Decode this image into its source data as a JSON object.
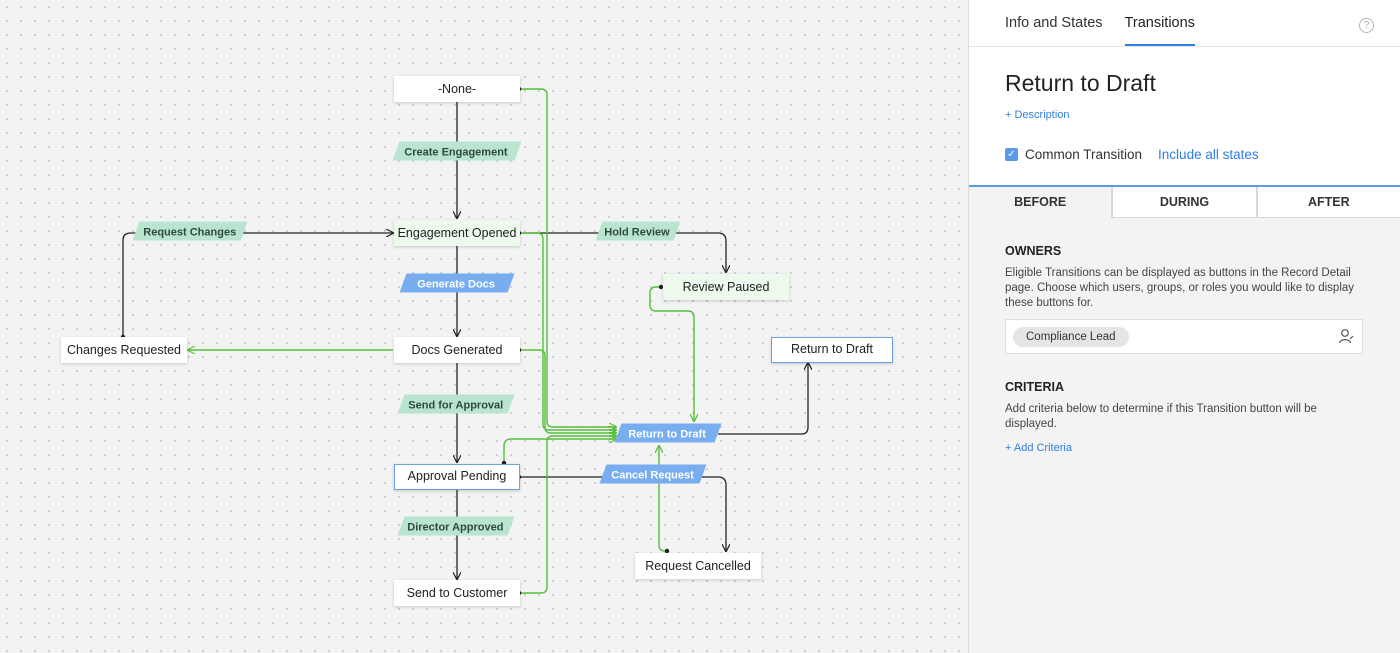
{
  "diagram": {
    "states": {
      "none": "-None-",
      "engagement_opened": "Engagement Opened",
      "docs_generated": "Docs Generated",
      "approval_pending": "Approval Pending",
      "send_to_customer": "Send to Customer",
      "changes_requested": "Changes Requested",
      "review_paused": "Review Paused",
      "return_to_draft": "Return to Draft",
      "request_cancelled": "Request Cancelled"
    },
    "transitions": {
      "create_engagement": "Create Engagement",
      "request_changes": "Request Changes",
      "hold_review": "Hold Review",
      "generate_docs": "Generate Docs",
      "send_for_approval": "Send for Approval",
      "return_to_draft": "Return to Draft",
      "cancel_request": "Cancel Request",
      "director_approved": "Director Approved"
    },
    "colors": {
      "normal_edge": "#222222",
      "common_edge": "#55bf3b",
      "transition_green": "#b9e5d0",
      "transition_blue": "#78aef0",
      "selected_border": "#6aa3e0"
    }
  },
  "panel": {
    "tabs": [
      "Info and States",
      "Transitions"
    ],
    "active_tab": "Transitions",
    "help_icon": "?",
    "title": "Return to Draft",
    "description_link": "+ Description",
    "common_transition_label": "Common Transition",
    "common_transition_checked": true,
    "include_all_states_link": "Include all states",
    "phase_tabs": [
      "BEFORE",
      "DURING",
      "AFTER"
    ],
    "active_phase": "BEFORE",
    "owners": {
      "title": "OWNERS",
      "description": "Eligible Transitions can be displayed as buttons in the Record Detail page. Choose which users, groups, or roles you would like to display these buttons for.",
      "chips": [
        "Compliance Lead"
      ],
      "icon": "user-icon"
    },
    "criteria": {
      "title": "CRITERIA",
      "description": "Add criteria below to determine if this Transition button will be displayed.",
      "add_link": "+ Add Criteria"
    }
  }
}
